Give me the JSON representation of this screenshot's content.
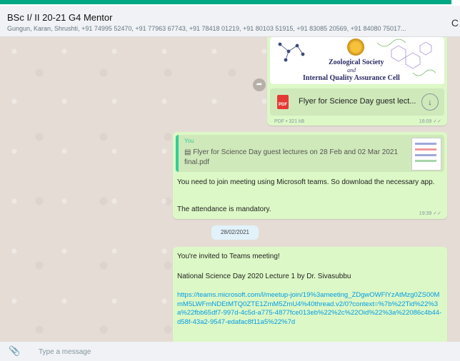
{
  "chat": {
    "title": "BSc I/ II 20-21 G4 Mentor",
    "participants": "Gungun, Karan, Shrushti, +91 74995 52470, +91 77963 67743, +91 78418 01219, +91 80103 51915, +91 83085 20569, +91 84080 75017...",
    "header_icon": "C"
  },
  "messages": [
    {
      "type": "document",
      "image_text": {
        "line1": "Zoological Society",
        "line2": "and",
        "line3": "Internal Quality Assurance Cell"
      },
      "file_name": "Flyer for Science Day guest lect...",
      "file_meta": "PDF • 321 kB",
      "time": "16:09 ✓✓",
      "icons": [
        "pdf-icon",
        "download-icon",
        "forward-icon"
      ]
    },
    {
      "type": "reply",
      "quote_author": "You",
      "quote_text": "▤ Flyer for Science Day guest lectures on 28 Feb and 02 Mar 2021 final.pdf",
      "text1": "You need to join meeting using Microsoft teams. So download the necessary app.",
      "text2": "The attendance is mandatory.",
      "time": "19:39 ✓✓"
    },
    {
      "type": "date",
      "label": "28/02/2021"
    },
    {
      "type": "text",
      "line1": "You're invited to Teams meeting!",
      "line2": "National Science Day 2020 Lecture 1 by Dr. Sivasubbu",
      "link": "https://teams.microsoft.com/l/meetup-join/19%3ameeting_ZDgwOWFlYzAtMzg0ZS00MmM5LWFmNDEtMTQ0ZTE1ZmM5ZmU4%40thread.v2/0?context=%7b%22Tid%22%3a%22fbb65df7-997d-4c5d-a775-4877fce013eb%22%2c%22Oid%22%3a%22086c4b44-d58f-43a2-9547-edafac8f11a5%22%7d"
    }
  ],
  "composer": {
    "placeholder": "Type a message",
    "icon": "paperclip-icon"
  },
  "colors": {
    "accent": "#00a884",
    "outgoing_bubble": "#dcf8c6",
    "link": "#039be5",
    "chat_background": "#e5ddd5"
  }
}
